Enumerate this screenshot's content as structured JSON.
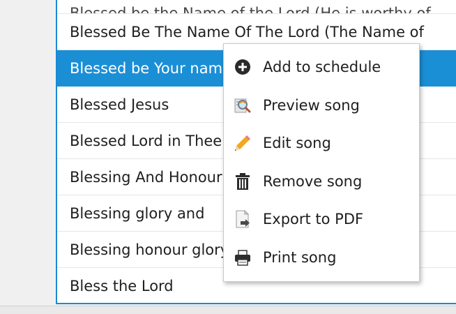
{
  "song_list": {
    "rows": [
      {
        "title": "Blessed be the Name of the Lord (He is worthy of",
        "partial": true,
        "selected": false
      },
      {
        "title": "Blessed Be The Name Of The Lord (The Name of",
        "partial": false,
        "selected": false
      },
      {
        "title": "Blessed be Your name",
        "partial": false,
        "selected": true
      },
      {
        "title": "Blessed Jesus",
        "partial": false,
        "selected": false
      },
      {
        "title": "Blessed Lord in Thee",
        "partial": false,
        "selected": false
      },
      {
        "title": "Blessing And Honour",
        "partial": false,
        "selected": false
      },
      {
        "title": "Blessing glory and",
        "partial": false,
        "selected": false
      },
      {
        "title": "Blessing honour glory",
        "partial": false,
        "selected": false
      },
      {
        "title": "Bless the Lord",
        "partial": false,
        "selected": false
      }
    ]
  },
  "context_menu": {
    "items": [
      {
        "label": "Add to schedule",
        "icon": "add-circle-icon"
      },
      {
        "label": "Preview song",
        "icon": "preview-magnifier-icon"
      },
      {
        "label": "Edit song",
        "icon": "pencil-icon"
      },
      {
        "label": "Remove song",
        "icon": "trash-icon"
      },
      {
        "label": "Export to PDF",
        "icon": "export-document-icon"
      },
      {
        "label": "Print song",
        "icon": "printer-icon"
      }
    ]
  },
  "colors": {
    "selection": "#1b8fd6",
    "list_border": "#1a8ad4"
  }
}
